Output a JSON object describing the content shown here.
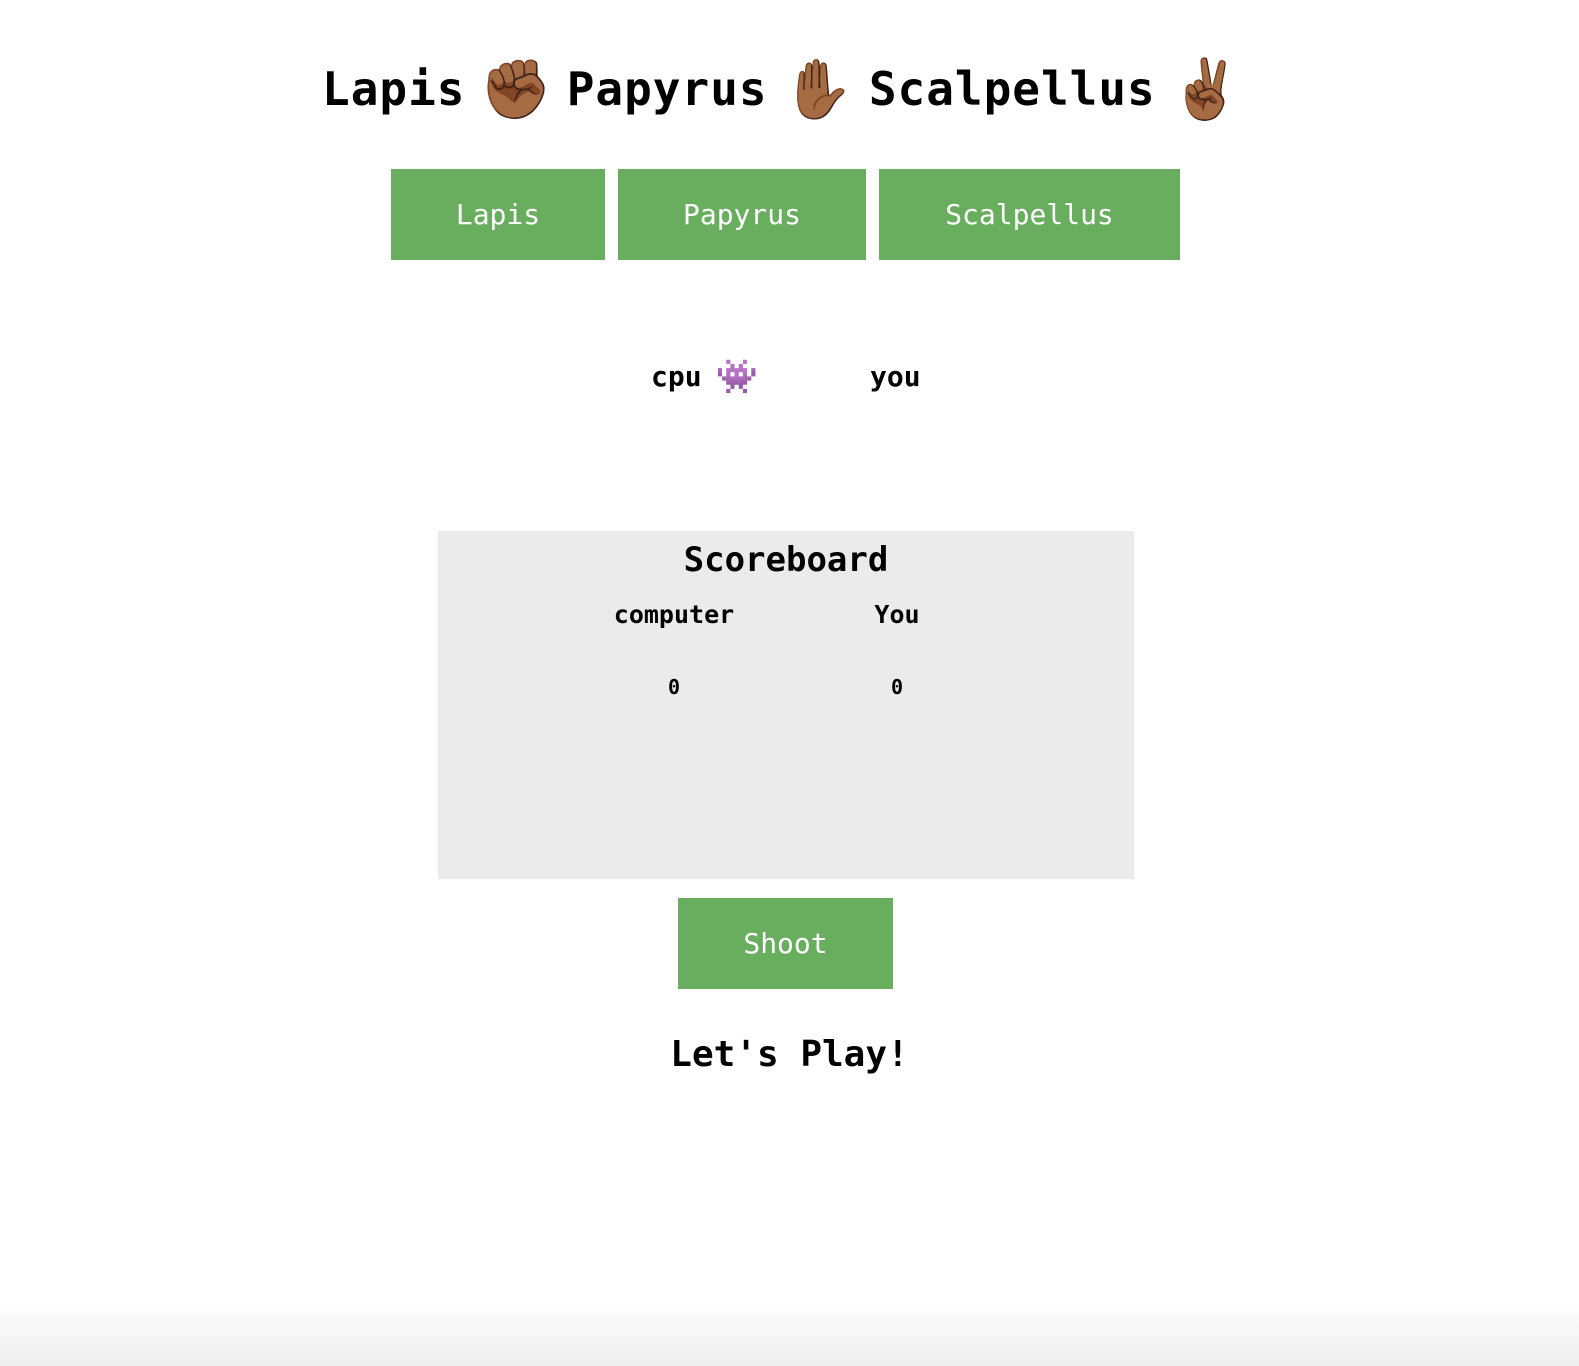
{
  "header": {
    "word1": "Lapis",
    "emoji1": "✊🏾",
    "word2": "Papyrus",
    "emoji2": "✋🏾",
    "word3": "Scalpellus",
    "emoji3": "✌🏾"
  },
  "choices": {
    "lapis": "Lapis",
    "papyrus": "Papyrus",
    "scalpellus": "Scalpellus"
  },
  "players": {
    "cpu_label": "cpu",
    "cpu_emoji": "👾",
    "you_label": "you"
  },
  "scoreboard": {
    "title": "Scoreboard",
    "computer_label": "computer",
    "you_label": "You",
    "computer_score": "0",
    "you_score": "0"
  },
  "shoot_label": "Shoot",
  "status": "Let's Play!",
  "icons": {
    "rock": "fist-icon",
    "paper": "raised-hand-icon",
    "scissors": "victory-hand-icon",
    "cpu": "alien-monster-icon"
  },
  "colors": {
    "button": "#69ad5f",
    "button_text": "#ffffff",
    "scoreboard_bg": "#ebebeb"
  }
}
